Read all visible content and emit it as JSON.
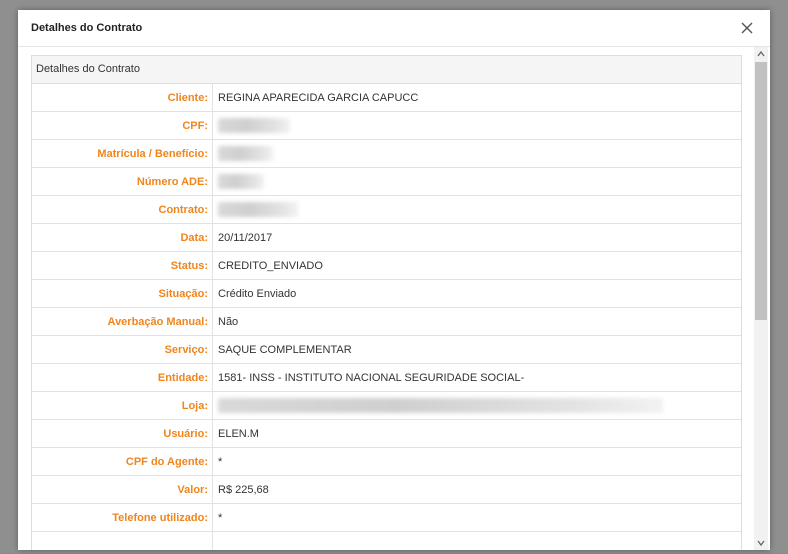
{
  "modal": {
    "title": "Detalhes do Contrato",
    "panel_heading": "Detalhes do Contrato"
  },
  "fields": [
    {
      "label": "Cliente:",
      "value": "REGINA APARECIDA GARCIA CAPUCC",
      "redacted": false
    },
    {
      "label": "CPF:",
      "value": "",
      "redacted": true
    },
    {
      "label": "Matrícula / Benefício:",
      "value": "",
      "redacted": true
    },
    {
      "label": "Número ADE:",
      "value": "",
      "redacted": true
    },
    {
      "label": "Contrato:",
      "value": "",
      "redacted": true
    },
    {
      "label": "Data:",
      "value": "20/11/2017",
      "redacted": false
    },
    {
      "label": "Status:",
      "value": "CREDITO_ENVIADO",
      "redacted": false
    },
    {
      "label": "Situação:",
      "value": "Crédito Enviado",
      "redacted": false
    },
    {
      "label": "Averbação Manual:",
      "value": "Não",
      "redacted": false
    },
    {
      "label": "Serviço:",
      "value": "SAQUE COMPLEMENTAR",
      "redacted": false
    },
    {
      "label": "Entidade:",
      "value": "1581- INSS - INSTITUTO NACIONAL SEGURIDADE SOCIAL-",
      "redacted": false
    },
    {
      "label": "Loja:",
      "value": "",
      "redacted": true
    },
    {
      "label": "Usuário:",
      "value": "ELEN.M",
      "redacted": false
    },
    {
      "label": "CPF do Agente:",
      "value": "*",
      "redacted": false
    },
    {
      "label": "Valor:",
      "value": "R$ 225,68",
      "redacted": false
    },
    {
      "label": "Telefone utilizado:",
      "value": "*",
      "redacted": false
    },
    {
      "label": "",
      "value": "",
      "redacted": false
    }
  ],
  "icons": {
    "close": "close-icon",
    "scroll_up": "scroll-up-icon",
    "scroll_down": "scroll-down-icon"
  },
  "colors": {
    "label": "#f0851c",
    "text": "#333333",
    "backdrop": "#8f8f8f"
  }
}
